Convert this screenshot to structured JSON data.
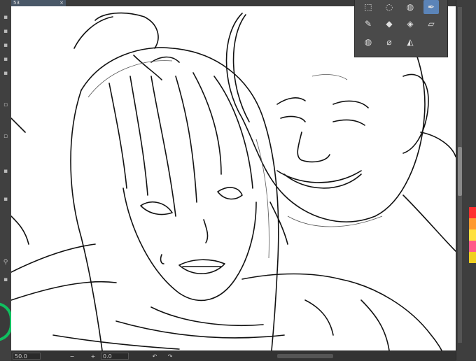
{
  "document_tab": {
    "label": "53",
    "close": "×"
  },
  "status_bar": {
    "zoom": "50.0",
    "rotation": "0.0",
    "zoom_out": "−",
    "zoom_in": "+",
    "rotate_left": "↶",
    "rotate_right": "↷"
  },
  "tool_palette": {
    "tools": [
      {
        "name": "rect-select-icon",
        "glyph": "⬚"
      },
      {
        "name": "lasso-select-icon",
        "glyph": "◌"
      },
      {
        "name": "lasso-fill-icon",
        "glyph": "◍"
      },
      {
        "name": "pen-icon",
        "glyph": "✒",
        "active": true
      },
      {
        "name": "ink-pen-icon",
        "glyph": "✎"
      },
      {
        "name": "bucket-icon",
        "glyph": "◆"
      },
      {
        "name": "fill-icon",
        "glyph": "◈"
      },
      {
        "name": "eraser-icon",
        "glyph": "▱"
      },
      {
        "name": "blend-drop-icon",
        "glyph": "💧"
      },
      {
        "name": "blur-drop-icon",
        "glyph": "⌀"
      },
      {
        "name": "smudge-icon",
        "glyph": "◭"
      }
    ]
  },
  "colors": {
    "accent": "#5b84b8",
    "ring": "#10c060",
    "swatches": [
      "#ff3030",
      "#ff9a30",
      "#ffe040",
      "#ff5a8a",
      "#f0d020"
    ]
  }
}
